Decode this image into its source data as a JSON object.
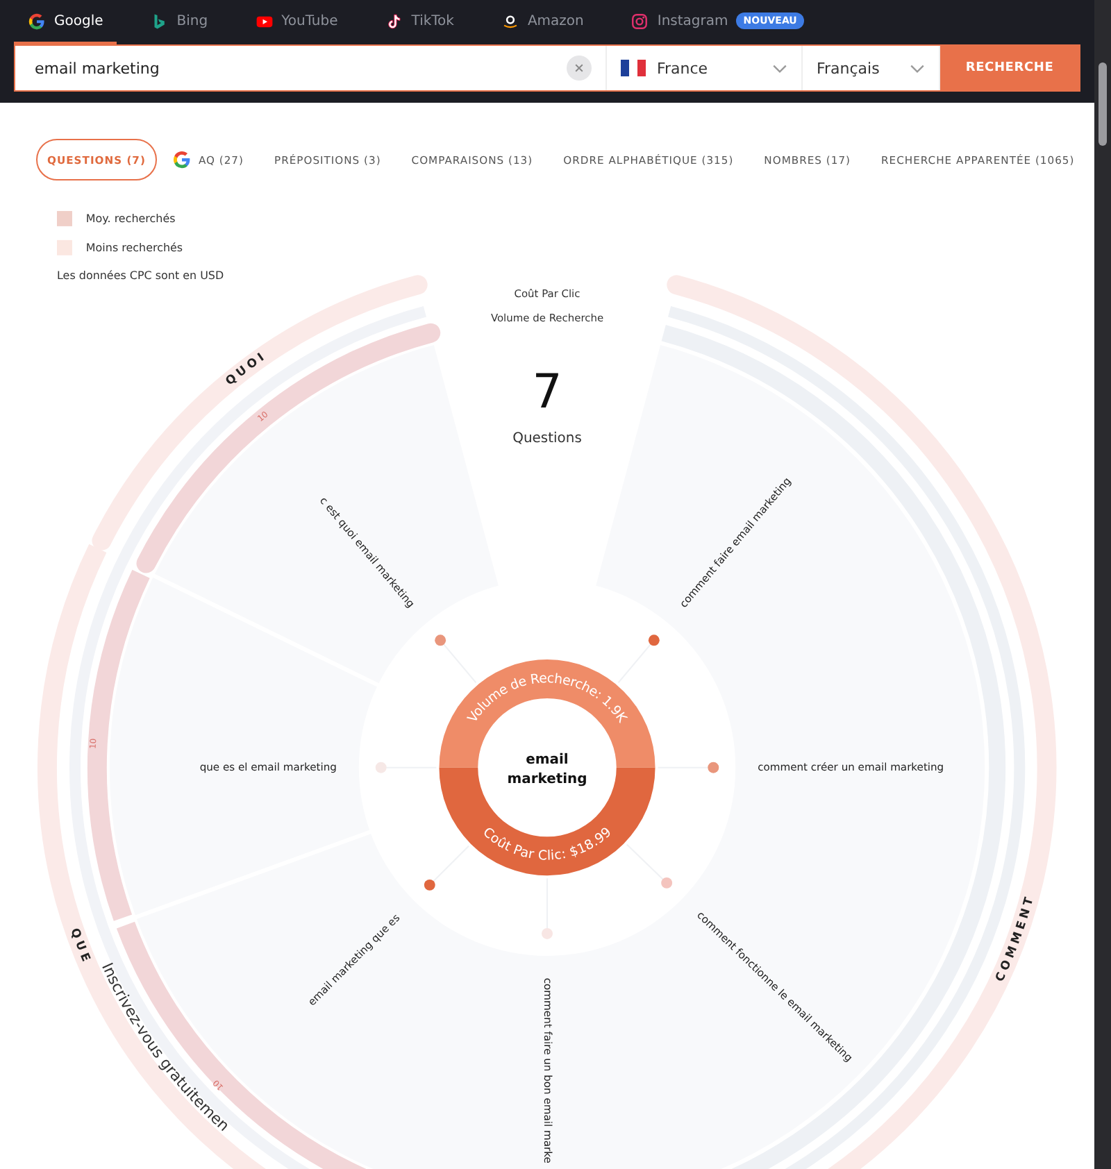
{
  "engine_tabs": [
    {
      "label": "Google",
      "kind": "google",
      "selected": true
    },
    {
      "label": "Bing",
      "kind": "bing",
      "selected": false
    },
    {
      "label": "YouTube",
      "kind": "youtube",
      "selected": false
    },
    {
      "label": "TikTok",
      "kind": "tiktok",
      "selected": false
    },
    {
      "label": "Amazon",
      "kind": "amazon",
      "selected": false
    },
    {
      "label": "Instagram",
      "kind": "instagram",
      "selected": false,
      "badge": "NOUVEAU"
    }
  ],
  "search": {
    "value": "email marketing",
    "country": "France",
    "language": "Français",
    "button": "RECHERCHE"
  },
  "result_tabs": [
    {
      "label": "QUESTIONS (7)",
      "selected": true
    },
    {
      "label": "AQ (27)",
      "kind": "google",
      "selected": false
    },
    {
      "label": "PRÉPOSITIONS (3)",
      "selected": false
    },
    {
      "label": "COMPARAISONS (13)",
      "selected": false
    },
    {
      "label": "ORDRE ALPHABÉTIQUE (315)",
      "selected": false
    },
    {
      "label": "NOMBRES (17)",
      "selected": false
    },
    {
      "label": "RECHERCHE APPARENTÉE (1065)",
      "selected": false
    }
  ],
  "legend": {
    "items": [
      {
        "label": "Moy. recherchés",
        "color": "#f0cfc8"
      },
      {
        "label": "Moins recherchés",
        "color": "#fbe7e1"
      }
    ],
    "note": "Les données CPC sont en USD"
  },
  "chart": {
    "metric_labels": [
      "Coût Par Clic",
      "Volume de Recherche"
    ],
    "count": "7",
    "count_label": "Questions",
    "center": [
      "email",
      "marketing"
    ],
    "ring_top": "Volume de Recherche: 1.9K",
    "ring_bottom": "Coût Par Clic: $18.99",
    "groups": [
      {
        "label": "QUOI",
        "questions": [
          {
            "text": "c est quoi email marketing",
            "color": "#e9967c"
          }
        ]
      },
      {
        "label": "COMMENT",
        "questions": [
          {
            "text": "comment faire email marketing",
            "color": "#e0673f"
          },
          {
            "text": "comment créer un email marketing",
            "color": "#e9967c"
          },
          {
            "text": "comment fonctionne le email marketing",
            "color": "#f4c4be"
          },
          {
            "text": "comment faire un bon email marke",
            "color": "#f8e6e4"
          }
        ]
      },
      {
        "label": "QUE",
        "questions": [
          {
            "text": "email marketing que es",
            "color": "#e0673f"
          },
          {
            "text": "que es el email marketing",
            "color": "#f6e8e6"
          }
        ]
      }
    ],
    "band_marks": [
      "10",
      "10",
      "10"
    ],
    "signup": "Inscrivez-vous gratuitemen"
  }
}
